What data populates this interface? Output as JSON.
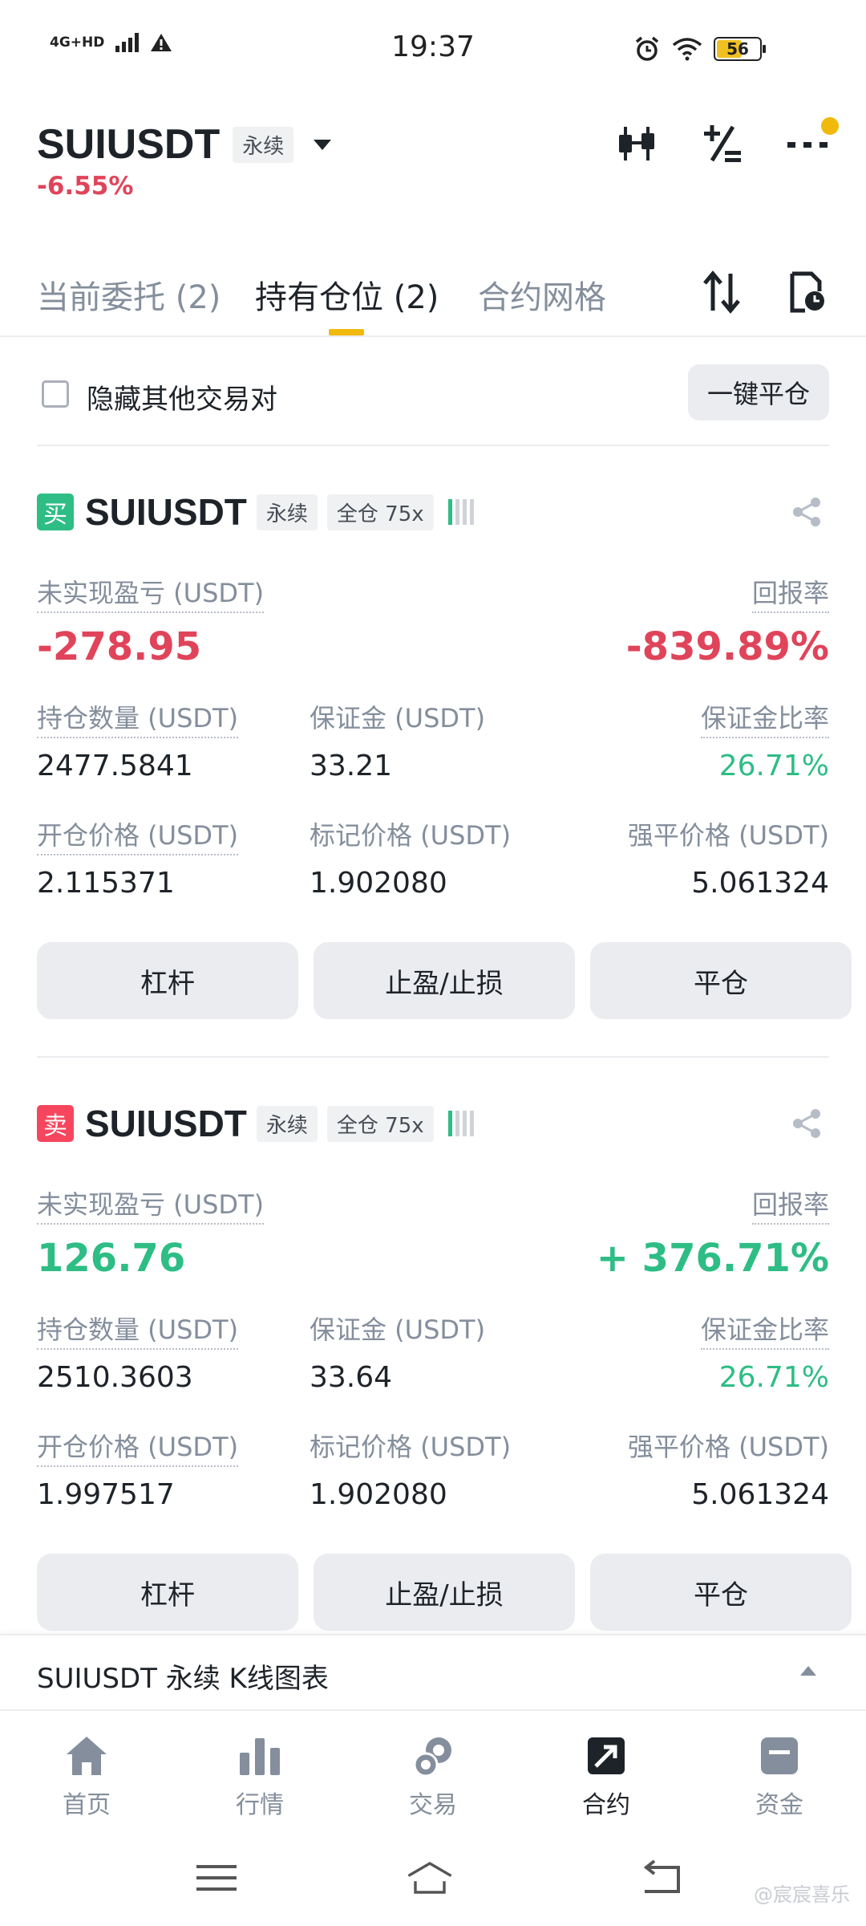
{
  "status_bar": {
    "network": "4G+HD",
    "time": "19:37",
    "battery": "56",
    "battery_level": 0.56
  },
  "header": {
    "symbol": "SUIUSDT",
    "contract_type": "永续",
    "change_pct": "-6.55%",
    "icons": [
      "candlestick-icon",
      "percent-icon",
      "more-icon"
    ]
  },
  "tabs": [
    {
      "label": "当前委托 (2)",
      "active": false
    },
    {
      "label": "持有仓位 (2)",
      "active": true
    },
    {
      "label": "合约网格",
      "active": false
    }
  ],
  "filter": {
    "hide_label": "隐藏其他交易对",
    "close_all_label": "一键平仓"
  },
  "positions": [
    {
      "side": "买",
      "symbol": "SUIUSDT",
      "contract_type": "永续",
      "margin_mode": "全仓 75x",
      "risk_level": 1,
      "pnl_label": "未实现盈亏 (USDT)",
      "pnl": "-278.95",
      "roe_label": "回报率",
      "roe": "-839.89%",
      "size_label": "持仓数量 (USDT)",
      "size": "2477.5841",
      "margin_label": "保证金 (USDT)",
      "margin": "33.21",
      "margin_ratio_label": "保证金比率",
      "margin_ratio": "26.71%",
      "entry_label": "开仓价格 (USDT)",
      "entry": "2.115371",
      "mark_label": "标记价格 (USDT)",
      "mark": "1.902080",
      "liq_label": "强平价格 (USDT)",
      "liq": "5.061324",
      "buttons": [
        "杠杆",
        "止盈/止损",
        "平仓"
      ]
    },
    {
      "side": "卖",
      "symbol": "SUIUSDT",
      "contract_type": "永续",
      "margin_mode": "全仓 75x",
      "risk_level": 1,
      "pnl_label": "未实现盈亏 (USDT)",
      "pnl": "126.76",
      "roe_label": "回报率",
      "roe": "+ 376.71%",
      "size_label": "持仓数量 (USDT)",
      "size": "2510.3603",
      "margin_label": "保证金 (USDT)",
      "margin": "33.64",
      "margin_ratio_label": "保证金比率",
      "margin_ratio": "26.71%",
      "entry_label": "开仓价格 (USDT)",
      "entry": "1.997517",
      "mark_label": "标记价格 (USDT)",
      "mark": "1.902080",
      "liq_label": "强平价格 (USDT)",
      "liq": "5.061324",
      "buttons": [
        "杠杆",
        "止盈/止损",
        "平仓"
      ]
    }
  ],
  "kline_bar": {
    "label": "SUIUSDT 永续 K线图表"
  },
  "bottom_nav": [
    {
      "label": "首页",
      "icon": "home-icon",
      "active": false
    },
    {
      "label": "行情",
      "icon": "markets-icon",
      "active": false
    },
    {
      "label": "交易",
      "icon": "trade-icon",
      "active": false
    },
    {
      "label": "合约",
      "icon": "futures-icon",
      "active": true
    },
    {
      "label": "资金",
      "icon": "wallet-icon",
      "active": false
    }
  ],
  "watermark": "@宸宸喜乐",
  "colors": {
    "accent": "#f0b90b",
    "up": "#2ebd85",
    "down": "#e0445a",
    "text_primary": "#1e2329",
    "text_secondary": "#848e9c"
  }
}
